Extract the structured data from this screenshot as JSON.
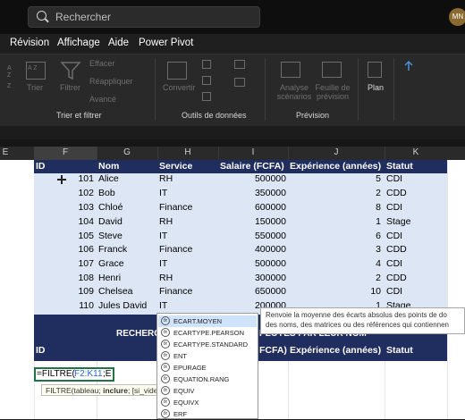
{
  "titlebar": {
    "search_placeholder": "Rechercher",
    "avatar": "MN"
  },
  "menu": [
    "Révision",
    "Affichage",
    "Aide",
    "Power Pivot"
  ],
  "ribbon": {
    "sort_az": "A Z",
    "sort_btn": "Trier",
    "filter_btn": "Filtrer",
    "filter_clear": "Effacer",
    "filter_reapply": "Réappliquer",
    "filter_advanced": "Avancé",
    "group_sort": "Trier et filtrer",
    "convert_btn": "Convertir",
    "group_data": "Outils de données",
    "whatif_btn": "Analyse scénarios",
    "forecast_btn": "Feuille de prévision",
    "group_forecast": "Prévision",
    "plan_btn": "Plan"
  },
  "columns": [
    "E",
    "F",
    "G",
    "H",
    "I",
    "J",
    "K"
  ],
  "table": {
    "headers": [
      "ID",
      "Nom",
      "Service",
      "Salaire (FCFA)",
      "Expérience (années)",
      "Statut"
    ],
    "rows": [
      [
        "101",
        "Alice",
        "RH",
        "500000",
        "5",
        "CDI"
      ],
      [
        "102",
        "Bob",
        "IT",
        "350000",
        "2",
        "CDD"
      ],
      [
        "103",
        "Chloé",
        "Finance",
        "600000",
        "8",
        "CDI"
      ],
      [
        "104",
        "David",
        "RH",
        "150000",
        "1",
        "Stage"
      ],
      [
        "105",
        "Steve",
        "IT",
        "550000",
        "6",
        "CDI"
      ],
      [
        "106",
        "Franck",
        "Finance",
        "400000",
        "3",
        "CDD"
      ],
      [
        "107",
        "Grace",
        "IT",
        "500000",
        "4",
        "CDI"
      ],
      [
        "108",
        "Henri",
        "RH",
        "300000",
        "2",
        "CDD"
      ],
      [
        "109",
        "Chelsea",
        "Finance",
        "650000",
        "10",
        "CDI"
      ],
      [
        "110",
        "Jules David",
        "IT",
        "200000",
        "1",
        "Stage"
      ]
    ]
  },
  "search_banner": {
    "left": "RECHERC",
    "right": "PLOYES PAR LEUR NOM"
  },
  "bottom_header": [
    "ID",
    "FCFA)",
    "Expérience (années)",
    "Statut"
  ],
  "formula": {
    "prefix": "=FILTRE(",
    "range": "F2:K11",
    "suffix": ";E"
  },
  "syntax_tip": {
    "text": "FILTRE(tableau; ",
    "bold": "inclure",
    "rest": "; [si_vide"
  },
  "autocomplete": [
    "ECART.MOYEN",
    "ECARTYPE.PEARSON",
    "ECARTYPE.STANDARD",
    "ENT",
    "EPURAGE",
    "EQUATION.RANG",
    "EQUIV",
    "EQUIVX",
    "ERF"
  ],
  "tooltip": "Renvoie la moyenne des écarts absolus des points de do des noms, des matrices ou des références qui contiennen"
}
